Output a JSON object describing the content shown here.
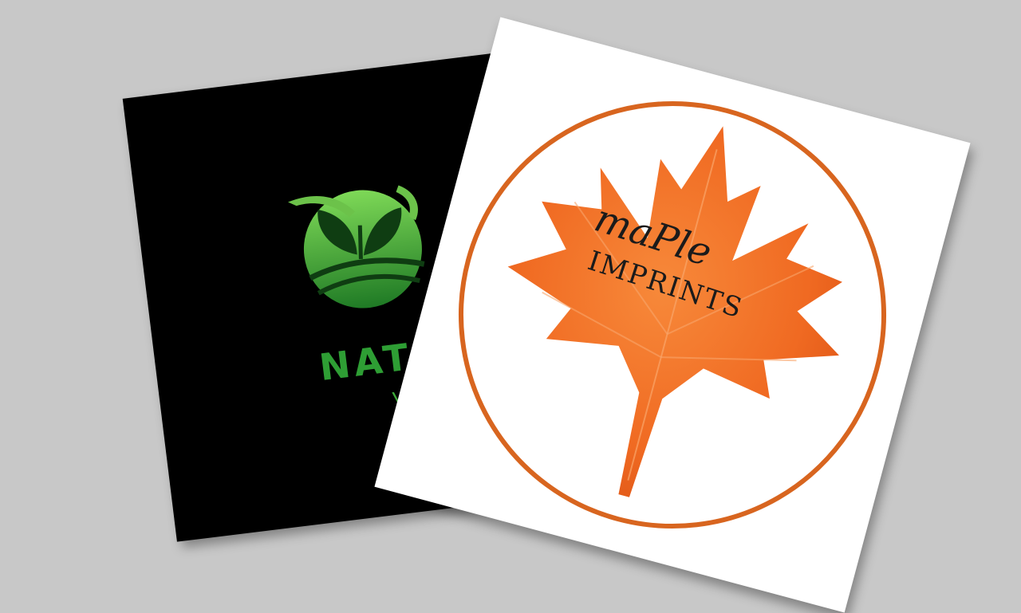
{
  "cards": {
    "back": {
      "brand_word": "NATU",
      "brand_subword": "VI",
      "emblem_icon": "leaf-sprout-field-icon",
      "background_color": "#000000",
      "brand_color": "#2e9e34"
    },
    "front": {
      "brand_line1": "maPle",
      "brand_line2": "IMPRINTS",
      "emblem_icon": "maple-leaf-icon",
      "leaf_color": "#f06a22",
      "ring_color": "#d8651f"
    }
  },
  "colors": {
    "page_background": "#c8c8c8"
  }
}
